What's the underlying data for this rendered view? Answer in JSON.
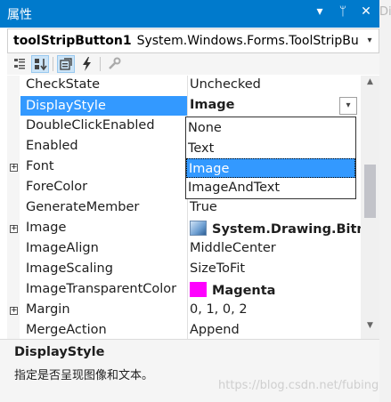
{
  "window": {
    "title": "属性",
    "buttons": {
      "dropdown": "▾",
      "pin": "ᛘ",
      "close": "✕"
    },
    "edge_text": "Di"
  },
  "object_selector": {
    "name": "toolStripButton1",
    "type": "System.Windows.Forms.ToolStripBu",
    "dropdown_glyph": "▾"
  },
  "toolbar": {
    "buttons": [
      {
        "name": "categorized",
        "pressed": false
      },
      {
        "name": "alphabetical",
        "pressed": true
      },
      {
        "name": "properties",
        "pressed": true
      },
      {
        "name": "events",
        "pressed": false
      },
      {
        "name": "property-pages",
        "pressed": false
      }
    ]
  },
  "grid": {
    "rows": [
      {
        "name": "CheckState",
        "value": "Unchecked"
      },
      {
        "name": "DisplayStyle",
        "value": "Image",
        "selected": true,
        "dropdown": "▾"
      },
      {
        "name": "DoubleClickEnabled",
        "value": ""
      },
      {
        "name": "Enabled",
        "value": ""
      },
      {
        "name": "Font",
        "value": "",
        "expand": "+"
      },
      {
        "name": "ForeColor",
        "value": ""
      },
      {
        "name": "GenerateMember",
        "value": "True"
      },
      {
        "name": "Image",
        "value": "System.Drawing.Bitm",
        "expand": "+"
      },
      {
        "name": "ImageAlign",
        "value": "MiddleCenter"
      },
      {
        "name": "ImageScaling",
        "value": "SizeToFit"
      },
      {
        "name": "ImageTransparentColor",
        "value": "Magenta",
        "swatch": "#ff00ff"
      },
      {
        "name": "Margin",
        "value": "0, 1, 0, 2",
        "expand": "+"
      },
      {
        "name": "MergeAction",
        "value": "Append"
      }
    ]
  },
  "dropdown": {
    "options": [
      "None",
      "Text",
      "Image",
      "ImageAndText"
    ],
    "selected": "Image"
  },
  "scrollbar": {
    "up": "▲",
    "down": "▼"
  },
  "description": {
    "title": "DisplayStyle",
    "text": "指定是否呈现图像和文本。"
  },
  "watermark": "https://blog.csdn.net/fubing",
  "colors": {
    "title_bar": "#007acc",
    "selection": "#3399ff",
    "magenta": "#ff00ff"
  }
}
